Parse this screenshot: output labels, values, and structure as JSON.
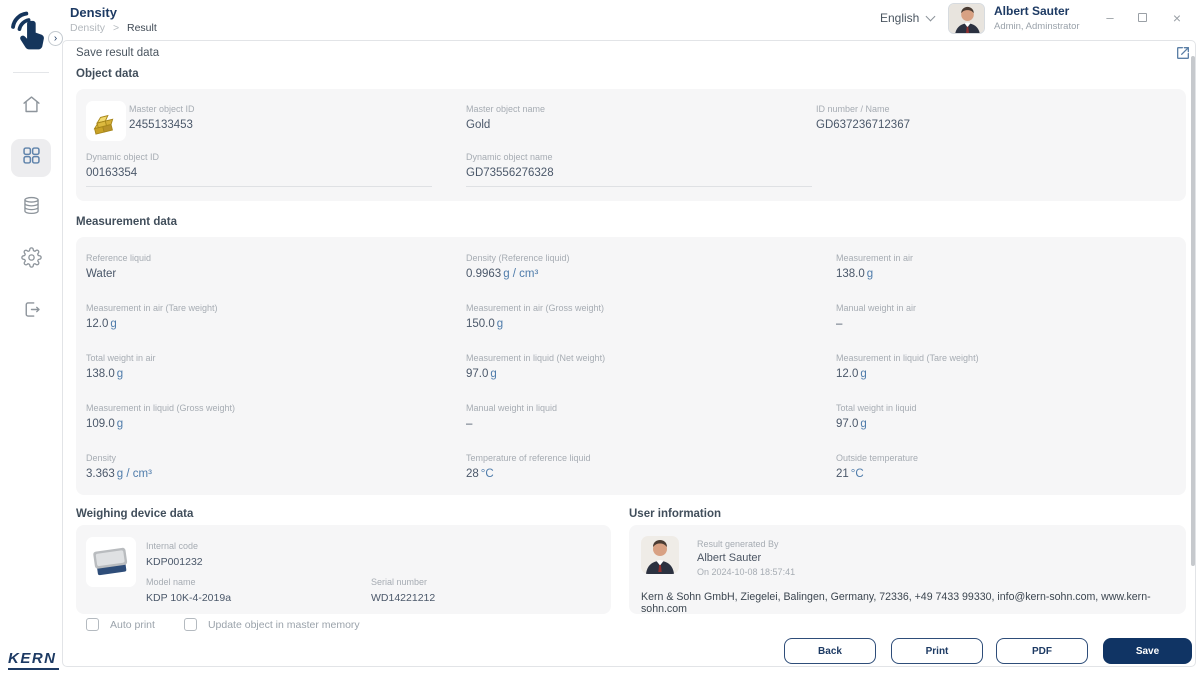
{
  "header": {
    "title": "Density",
    "breadcrumb": {
      "parent": "Density",
      "separator": ">",
      "current": "Result"
    },
    "language": "English",
    "user": {
      "name": "Albert Sauter",
      "role": "Admin, Adminstrator"
    },
    "window_controls": {
      "minimize": "–",
      "close": "×"
    }
  },
  "sidebar": {
    "expand_chevron": "›",
    "logo_text": "KERN"
  },
  "page": {
    "title": "Save result data"
  },
  "object_data": {
    "section_title": "Object data",
    "fields": [
      {
        "label": "Master object ID",
        "value": "2455133453"
      },
      {
        "label": "Master object name",
        "value": "Gold"
      },
      {
        "label": "ID number / Name",
        "value": "GD637236712367"
      },
      {
        "label": "Dynamic object ID",
        "value": "00163354"
      },
      {
        "label": "Dynamic object name",
        "value": "GD73556276328"
      }
    ]
  },
  "measurement": {
    "section_title": "Measurement data",
    "fields": [
      {
        "label": "Reference liquid",
        "value": "Water",
        "unit": ""
      },
      {
        "label": "Density (Reference liquid)",
        "value": "0.9963",
        "unit": "g / cm³"
      },
      {
        "label": "Measurement in air",
        "value": "138.0",
        "unit": "g"
      },
      {
        "label": "Measurement in air (Tare weight)",
        "value": "12.0",
        "unit": "g"
      },
      {
        "label": "Measurement in air (Gross weight)",
        "value": "150.0",
        "unit": "g"
      },
      {
        "label": "Manual weight in air",
        "value": "–",
        "unit": ""
      },
      {
        "label": "Total weight in air",
        "value": "138.0",
        "unit": "g"
      },
      {
        "label": "Measurement in liquid (Net weight)",
        "value": "97.0",
        "unit": "g"
      },
      {
        "label": "Measurement in liquid (Tare weight)",
        "value": "12.0",
        "unit": "g"
      },
      {
        "label": "Measurement in liquid (Gross weight)",
        "value": "109.0",
        "unit": "g"
      },
      {
        "label": "Manual weight in liquid",
        "value": "–",
        "unit": ""
      },
      {
        "label": "Total weight in liquid",
        "value": "97.0",
        "unit": "g"
      },
      {
        "label": "Density",
        "value": "3.363",
        "unit": "g / cm³"
      },
      {
        "label": "Temperature of reference liquid",
        "value": "28",
        "unit": "°C"
      },
      {
        "label": "Outside temperature",
        "value": "21",
        "unit": "°C"
      }
    ]
  },
  "device": {
    "section_title": "Weighing device data",
    "fields": [
      {
        "label": "Internal code",
        "value": "KDP001232"
      },
      {
        "label": "Model name",
        "value": "KDP 10K-4-2019a"
      },
      {
        "label": "Serial number",
        "value": "WD14221212"
      }
    ]
  },
  "user_info": {
    "section_title": "User information",
    "generated_by_label": "Result generated By",
    "generated_by": "Albert Sauter",
    "generated_on": "On 2024-10-08 18:57:41",
    "company_line": "Kern & Sohn GmbH, Ziegelei, Balingen, Germany, 72336, +49 7433 99330, info@kern-sohn.com, www.kern-sohn.com"
  },
  "options": {
    "auto_print": {
      "label": "Auto print",
      "checked": false
    },
    "update_object": {
      "label": "Update object in master memory",
      "checked": false
    }
  },
  "actions": {
    "back": "Back",
    "print": "Print",
    "pdf": "PDF",
    "save": "Save"
  },
  "colors": {
    "brand_navy": "#103464",
    "accent_blue": "#4f7cab",
    "card_bg": "#f6f6f7",
    "label_gray": "#a6acb3"
  }
}
